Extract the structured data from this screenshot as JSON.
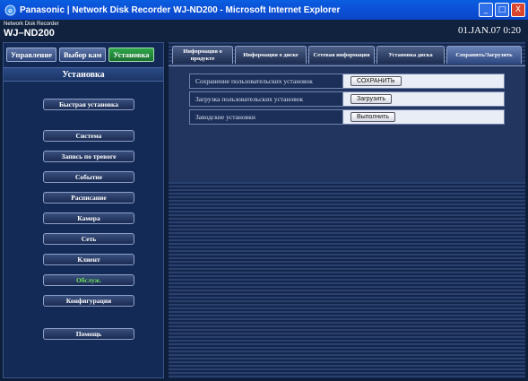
{
  "window": {
    "title": "Panasonic | Network Disk Recorder WJ-ND200 - Microsoft Internet Explorer",
    "controls": {
      "minimize": "_",
      "maximize": "□",
      "close": "X"
    }
  },
  "header": {
    "subtitle": "Network Disk Recorder",
    "model": "WJ–ND200",
    "datetime": "01.JAN.07  0:20"
  },
  "topnav": [
    "Управление",
    "Выбор кам",
    "Установка"
  ],
  "sidebar": {
    "heading": "Установка",
    "items": [
      "Быстрая установка",
      "Система",
      "Запись по тревоге",
      "Событие",
      "Расписание",
      "Камера",
      "Сеть",
      "Клиент",
      "Обслуж.",
      "Конфигурация",
      "Помощь"
    ],
    "active_index": 8
  },
  "tabs": [
    "Информация о продукте",
    "Информация о диске",
    "Сетевая информация",
    "Установка диска",
    "Сохранить/Загрузить"
  ],
  "active_tab_index": 4,
  "settings": [
    {
      "label": "Сохранение пользовательских установок",
      "button": "СОХРАНИТЬ"
    },
    {
      "label": "Загрузка пользовательских установок",
      "button": "Загрузить"
    },
    {
      "label": "Заводские установки",
      "button": "Выполнить"
    }
  ],
  "colors": {
    "titlebar": "#0b52d8",
    "app_background": "#0d1e3a",
    "active_nav": "#2fa84a",
    "active_menu_text": "#6fe05a"
  }
}
